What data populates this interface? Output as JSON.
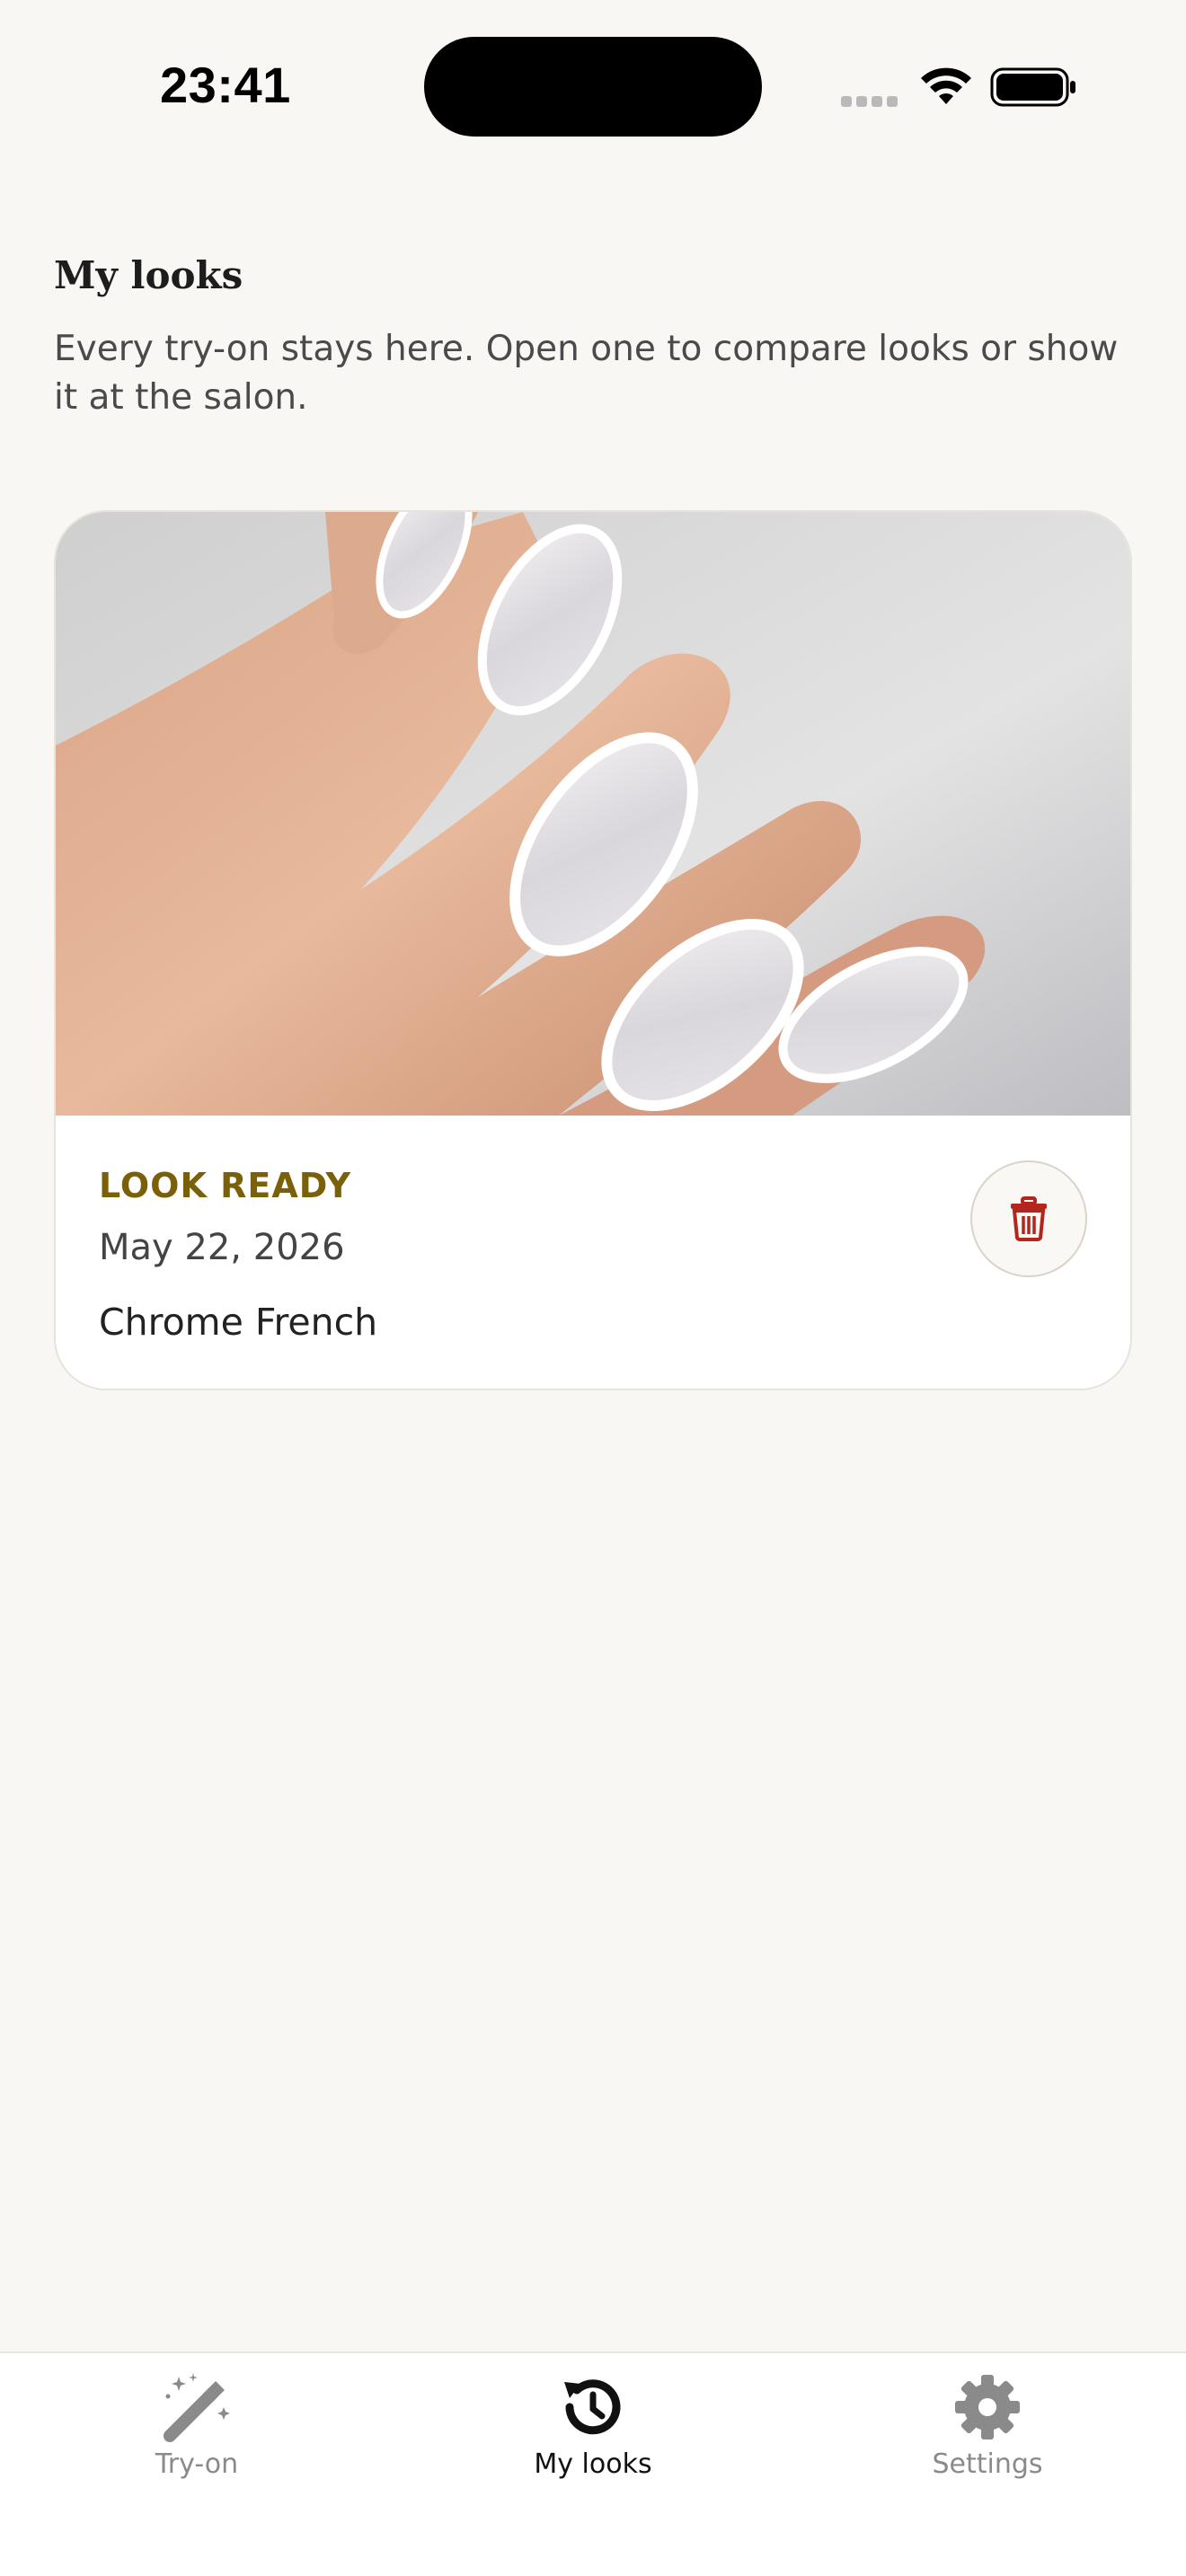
{
  "status_bar": {
    "time": "23:41"
  },
  "header": {
    "title": "My looks",
    "subtitle": "Every try-on stays here. Open one to compare looks or show it at the salon."
  },
  "looks": [
    {
      "status": "LOOK READY",
      "date": "May 22, 2026",
      "name": "Chrome French",
      "delete_icon": "trash-icon"
    }
  ],
  "tab_bar": {
    "tabs": [
      {
        "label": "Try-on",
        "icon": "magic-wand-icon",
        "active": false
      },
      {
        "label": "My looks",
        "icon": "history-icon",
        "active": true
      },
      {
        "label": "Settings",
        "icon": "gear-icon",
        "active": false
      }
    ]
  },
  "colors": {
    "background": "#f8f7f4",
    "status_accent": "#7a6008",
    "delete_red": "#b3261e",
    "tab_active": "#111111",
    "tab_inactive": "#8a8a8a"
  }
}
